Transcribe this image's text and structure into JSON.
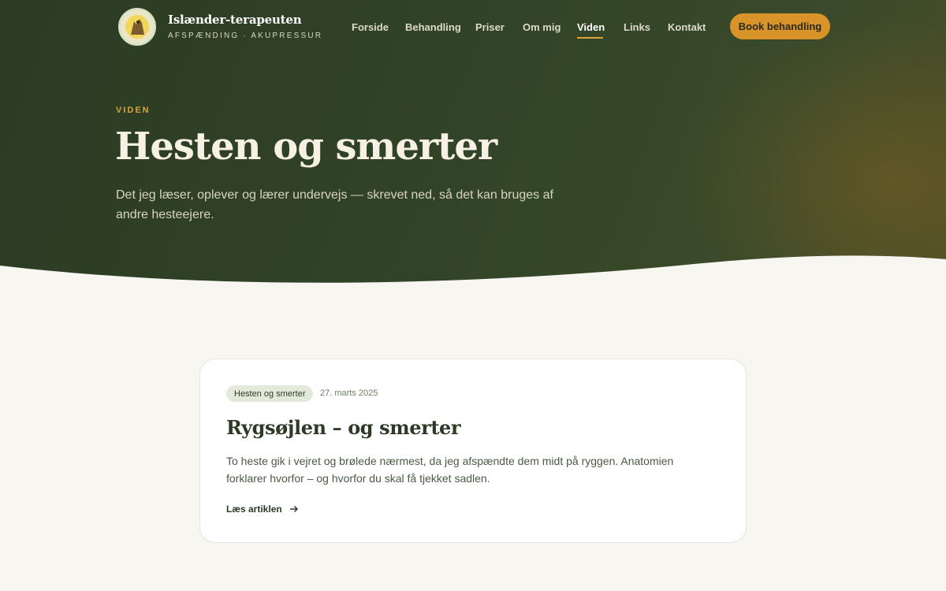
{
  "brand": {
    "name": "Islænder-terapeuten",
    "tagline": "AFSPÆNDING · AKUPRESSUR"
  },
  "nav": {
    "items": [
      {
        "label": "Forside"
      },
      {
        "label": "Behandling"
      },
      {
        "label": "Priser"
      },
      {
        "label": "Om mig"
      },
      {
        "label": "Viden",
        "active": true
      },
      {
        "label": "Links"
      },
      {
        "label": "Kontakt"
      }
    ],
    "cta_label": "Book behandling"
  },
  "hero": {
    "eyebrow": "VIDEN",
    "title": "Hesten og smerter",
    "intro": "Det jeg læser, oplever og lærer undervejs — skrevet ned, så det kan bruges af andre hesteejere."
  },
  "article": {
    "tag": "Hesten og smerter",
    "date": "27. marts 2025",
    "title": "Rygsøjlen – og smerter",
    "excerpt": "To heste gik i vejret og brølede nærmest, da jeg afspændte dem midt på ryggen. Anatomien forklarer hvorfor – og hvorfor du skal få tjekket sadlen.",
    "read_more": "Læs artiklen"
  },
  "colors": {
    "hero_green": "#2f4026",
    "accent": "#d99429",
    "page_bg": "#f7f6f1"
  }
}
